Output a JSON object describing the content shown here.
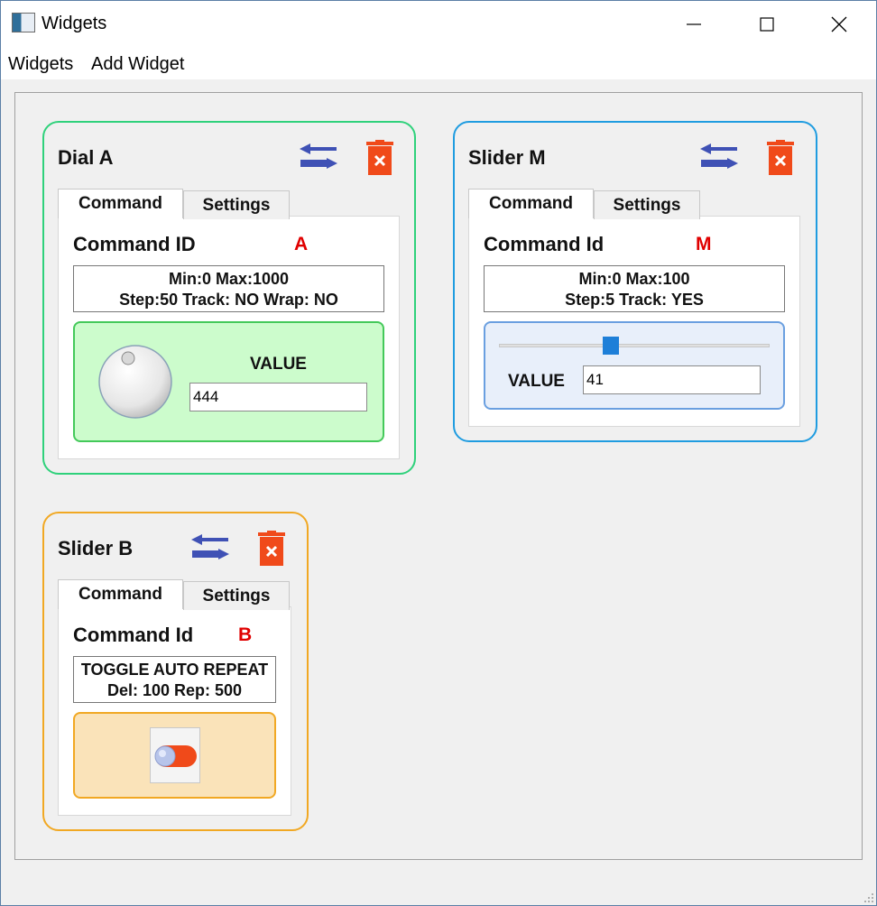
{
  "window": {
    "title": "Widgets"
  },
  "menu": [
    "Widgets",
    "Add Widget"
  ],
  "colors": {
    "dial_border": "#2fd17b",
    "slider_m_border": "#1f9ce0",
    "slider_b_border": "#f1a823",
    "id_red": "#e00000",
    "delete_red": "#f04a1a",
    "swap_blue": "#3f51b5"
  },
  "widgets": {
    "dial_a": {
      "title": "Dial A",
      "tabs": [
        "Command",
        "Settings"
      ],
      "id_label": "Command ID",
      "id_value": "A",
      "info_line1": "Min:0 Max:1000",
      "info_line2": "Step:50 Track: NO Wrap: NO",
      "value_label": "VALUE",
      "value": "444"
    },
    "slider_m": {
      "title": "Slider M",
      "tabs": [
        "Command",
        "Settings"
      ],
      "id_label": "Command Id",
      "id_value": "M",
      "info_line1": "Min:0 Max:100",
      "info_line2": "Step:5 Track: YES",
      "value_label": "VALUE",
      "value": "41"
    },
    "slider_b": {
      "title": "Slider B",
      "tabs": [
        "Command",
        "Settings"
      ],
      "id_label": "Command Id",
      "id_value": "B",
      "info_line1": "TOGGLE AUTO REPEAT",
      "info_line2": "Del: 100 Rep: 500"
    }
  },
  "icons": {
    "swap": "swap-arrows-icon",
    "delete": "trash-delete-icon",
    "toggle": "toggle-switch-icon",
    "dial": "dial-knob-icon"
  }
}
